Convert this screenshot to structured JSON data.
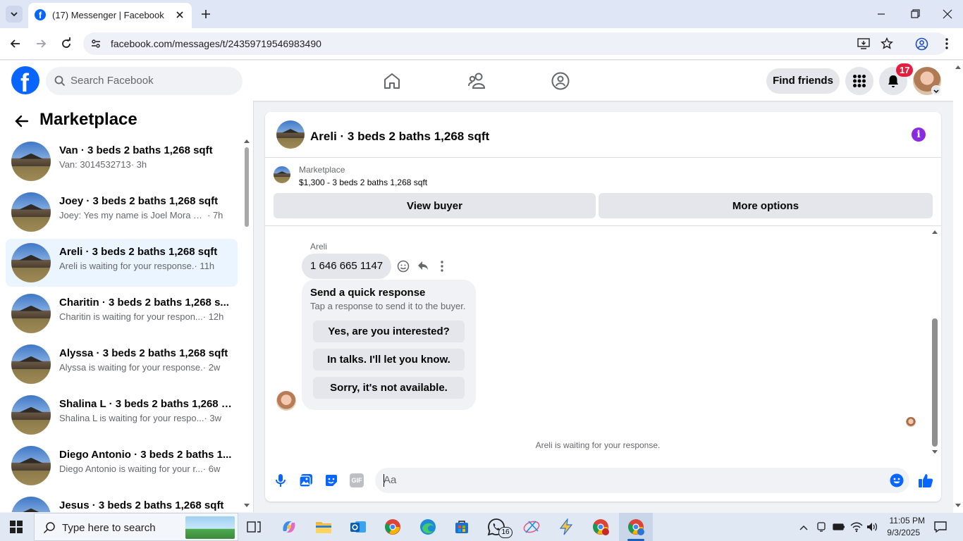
{
  "browser": {
    "tab_title": "(17) Messenger | Facebook",
    "url": "facebook.com/messages/t/24359719546983490"
  },
  "header": {
    "search_placeholder": "Search Facebook",
    "find_friends": "Find friends",
    "notification_count": "17"
  },
  "sidebar": {
    "title": "Marketplace",
    "conversations": [
      {
        "name": "Van · 3 beds 2 baths 1,268 sqft",
        "snippet": "Van: 3014532713",
        "time": "· 3h",
        "selected": false
      },
      {
        "name": "Joey · 3 beds 2 baths 1,268 sqft",
        "snippet": "Joey: Yes my name is Joel Mora my ...",
        "time": "· 7h",
        "selected": false
      },
      {
        "name": "Areli · 3 beds 2 baths 1,268 sqft",
        "snippet": "Areli is waiting for your response.",
        "time": "· 11h",
        "selected": true
      },
      {
        "name": "Charitin · 3 beds 2 baths 1,268 s...",
        "snippet": "Charitin is waiting for your respon...",
        "time": "· 12h",
        "selected": false
      },
      {
        "name": "Alyssa · 3 beds 2 baths 1,268 sqft",
        "snippet": "Alyssa is waiting for your response.",
        "time": "· 2w",
        "selected": false
      },
      {
        "name": "Shalina L · 3 beds 2 baths 1,268 s...",
        "snippet": "Shalina L is waiting for your respo...",
        "time": "· 3w",
        "selected": false
      },
      {
        "name": "Diego Antonio · 3 beds 2 baths 1...",
        "snippet": "Diego Antonio is waiting for your r...",
        "time": "· 6w",
        "selected": false
      },
      {
        "name": "Jesus · 3 beds 2 baths 1,268 sqft",
        "snippet": "",
        "time": "",
        "selected": false
      }
    ]
  },
  "chat": {
    "title": "Areli · 3 beds 2 baths 1,268 sqft",
    "listing_source": "Marketplace",
    "listing_desc": "$1,300 - 3 beds 2 baths 1,268 sqft",
    "view_buyer": "View buyer",
    "more_options": "More options",
    "sender": "Areli",
    "message": "1 646 665 1147",
    "quick_title": "Send a quick response",
    "quick_subtitle": "Tap a response to send it to the buyer.",
    "quick_responses": [
      "Yes, are you interested?",
      "In talks. I'll let you know.",
      "Sorry, it's not available."
    ],
    "status": "Areli is waiting for your response.",
    "composer_placeholder": "Aa",
    "accent_color": "#0866ff",
    "info_color": "#8a2be2"
  },
  "taskbar": {
    "search_placeholder": "Type here to search",
    "time": "11:05 PM",
    "date": "9/3/2025",
    "whatsapp_badge": "16"
  }
}
